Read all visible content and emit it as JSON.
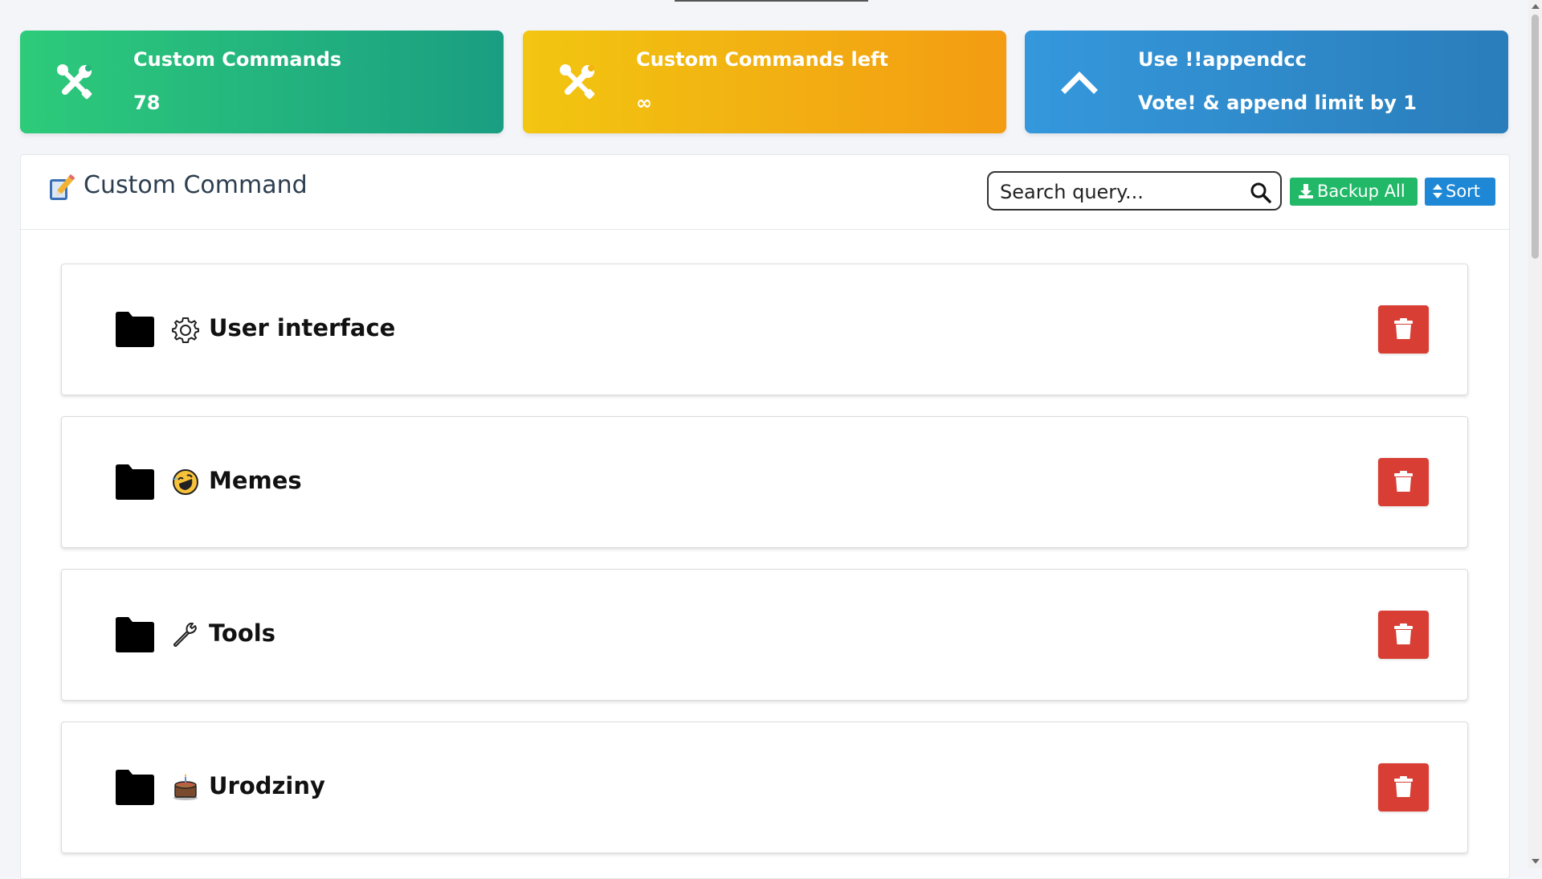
{
  "stats": [
    {
      "title": "Custom Commands",
      "value": "78",
      "icon": "tools-icon"
    },
    {
      "title": "Custom Commands left",
      "value": "∞",
      "icon": "tools-icon"
    },
    {
      "title": "Use !!appendcc",
      "value": "Vote! & append limit by 1",
      "icon": "chevron-up-icon"
    }
  ],
  "panel": {
    "title": "Custom Command",
    "icon": "pencil-memo-icon",
    "search": {
      "placeholder": "Search query...",
      "value": ""
    },
    "backup_label": "Backup All",
    "sort_label": "Sort"
  },
  "folders": [
    {
      "name": "User interface",
      "icon": "gear-icon"
    },
    {
      "name": "Memes",
      "icon": "laughing-emoji-icon"
    },
    {
      "name": "Tools",
      "icon": "wrench-icon"
    },
    {
      "name": "Urodziny",
      "icon": "cake-icon"
    }
  ],
  "colors": {
    "green_card": "#2dcb7a",
    "yellow_card": "#f2c611",
    "blue_card": "#3598dc",
    "delete_button": "#d83e33",
    "backup_button": "#21b868",
    "sort_button": "#1e88d6"
  }
}
